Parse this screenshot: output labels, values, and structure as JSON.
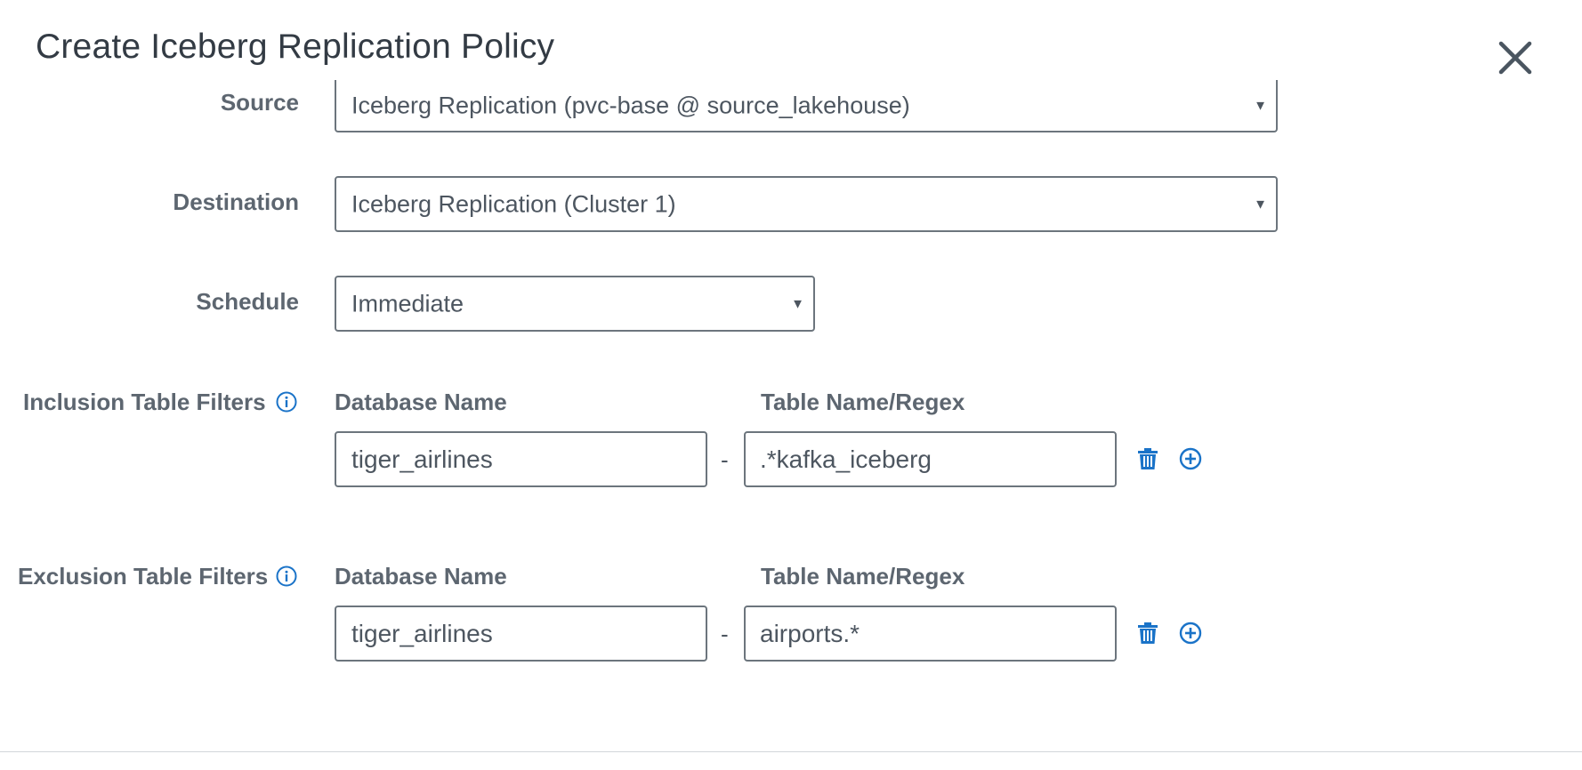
{
  "modal": {
    "title": "Create Iceberg Replication Policy"
  },
  "form": {
    "source": {
      "label": "Source",
      "value": "Iceberg Replication (pvc-base @ source_lakehouse)"
    },
    "destination": {
      "label": "Destination",
      "value": "Iceberg Replication (Cluster 1)"
    },
    "schedule": {
      "label": "Schedule",
      "value": "Immediate"
    },
    "inclusion_filters": {
      "label": "Inclusion Table Filters",
      "database_header": "Database Name",
      "table_header": "Table Name/Regex",
      "rows": [
        {
          "database": "tiger_airlines",
          "separator": "-",
          "table": ".*kafka_iceberg"
        }
      ]
    },
    "exclusion_filters": {
      "label": "Exclusion Table Filters",
      "database_header": "Database Name",
      "table_header": "Table Name/Regex",
      "rows": [
        {
          "database": "tiger_airlines",
          "separator": "-",
          "table": "airports.*"
        }
      ]
    }
  },
  "icons": {
    "close": "close-icon",
    "info": "info-icon",
    "delete": "trash-icon",
    "add": "plus-circle-icon",
    "dropdown": "caret-down-icon"
  },
  "colors": {
    "accent": "#1a73c8",
    "text": "#4d5660",
    "label": "#5d6670",
    "border": "#6c757d"
  }
}
